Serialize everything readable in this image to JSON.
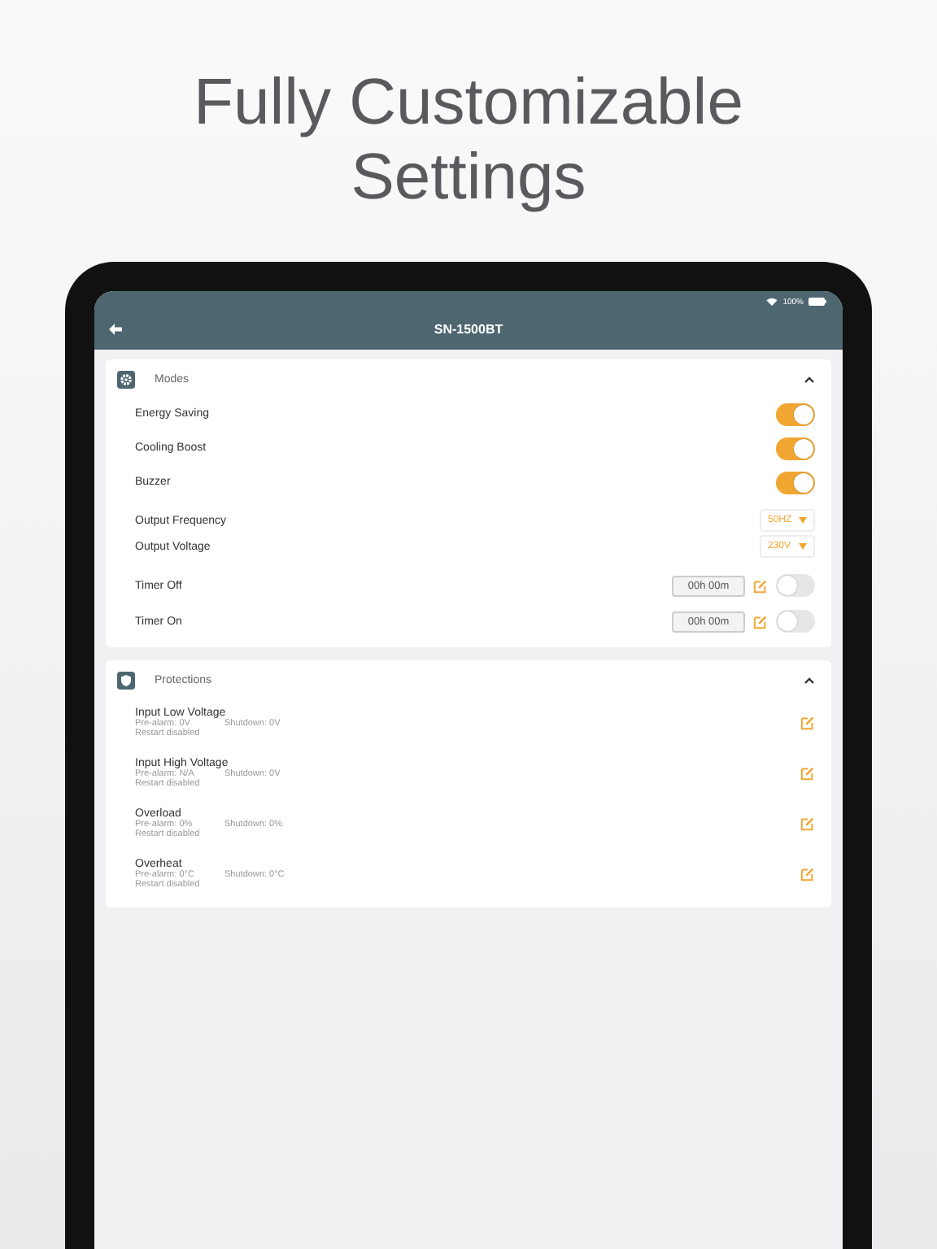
{
  "headline": "Fully Customizable Settings",
  "status_bar": {
    "battery": "100%"
  },
  "header": {
    "title": "SN-1500BT"
  },
  "modes": {
    "title": "Modes",
    "expanded": true,
    "toggles": [
      {
        "label": "Energy Saving",
        "on": true
      },
      {
        "label": "Cooling Boost",
        "on": true
      },
      {
        "label": "Buzzer",
        "on": true
      }
    ],
    "selects": [
      {
        "label": "Output Frequency",
        "value": "50HZ"
      },
      {
        "label": "Output Voltage",
        "value": "230V"
      }
    ],
    "timers": [
      {
        "label": "Timer Off",
        "value": "00h 00m",
        "on": false
      },
      {
        "label": "Timer On",
        "value": "00h 00m",
        "on": false
      }
    ]
  },
  "protections": {
    "title": "Protections",
    "expanded": true,
    "items": [
      {
        "name": "Input Low Voltage",
        "pre_alarm": "Pre-alarm: 0V",
        "shutdown": "Shutdown: 0V",
        "restart": "Restart disabled"
      },
      {
        "name": "Input High Voltage",
        "pre_alarm": "Pre-alarm: N/A",
        "shutdown": "Shutdown: 0V",
        "restart": "Restart disabled"
      },
      {
        "name": "Overload",
        "pre_alarm": "Pre-alarm: 0%",
        "shutdown": "Shutdown: 0%",
        "restart": "Restart disabled"
      },
      {
        "name": "Overheat",
        "pre_alarm": "Pre-alarm: 0°C",
        "shutdown": "Shutdown: 0°C",
        "restart": "Restart disabled"
      }
    ]
  }
}
